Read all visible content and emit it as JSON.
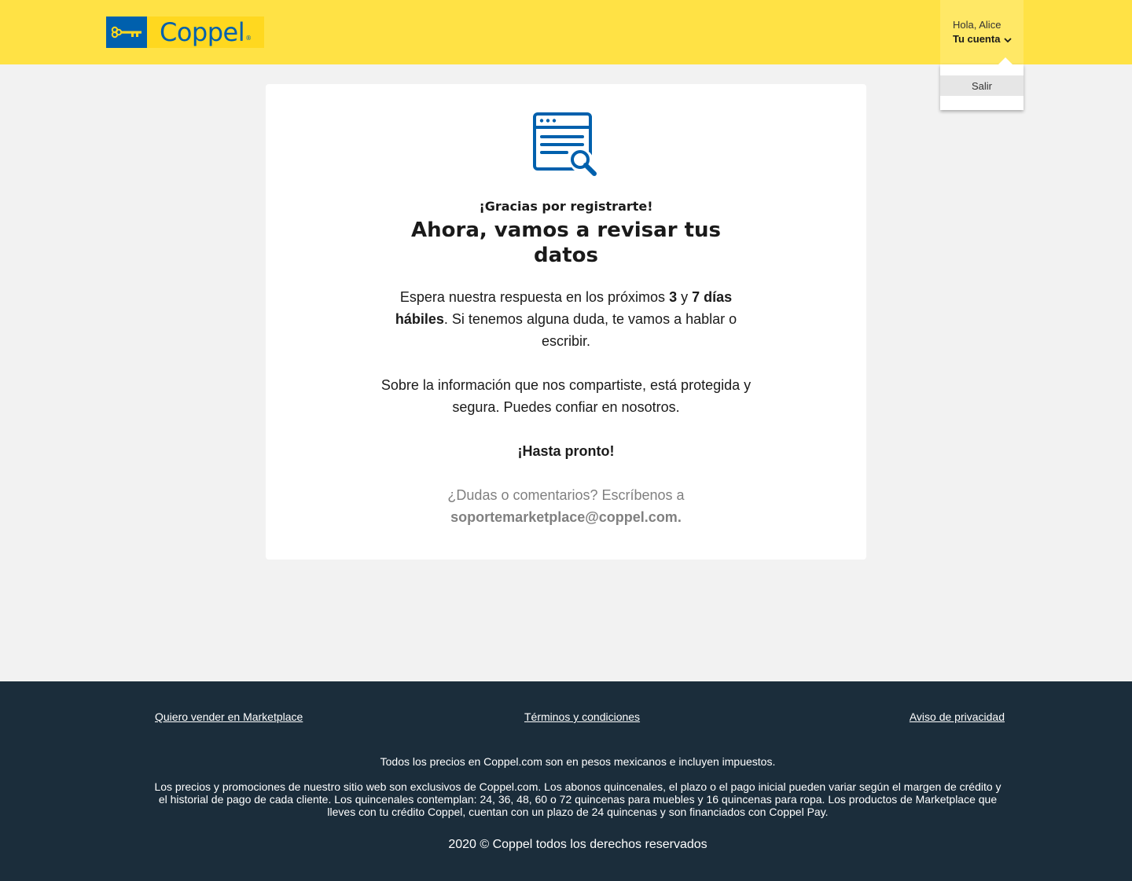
{
  "header": {
    "logo_text": "Coppel",
    "logo_mark": "®",
    "greeting": "Hola, Alice",
    "account_label": "Tu cuenta",
    "brand_yellow": "#ffe245",
    "brand_blue": "#0060ad"
  },
  "dropdown": {
    "items": [
      {
        "label": "Salir"
      }
    ]
  },
  "card": {
    "icon": "browser-search-icon",
    "thanks": "¡Gracias por registrarte!",
    "headline": "Ahora, vamos a revisar tus datos",
    "p1_a": "Espera nuestra respuesta en los próximos ",
    "p1_b": "3",
    "p1_c": " y ",
    "p1_d": "7 días hábiles",
    "p1_e": ". Si tenemos alguna duda, te vamos a hablar o escribir.",
    "p2": "Sobre la información que nos compartiste, está protegida y segura. Puedes confiar en nosotros.",
    "p3": "¡Hasta pronto!",
    "p4_a": "¿Dudas o comentarios? Escríbenos a ",
    "p4_email": "soportemarketplace@coppel.com."
  },
  "footer": {
    "links": [
      {
        "label": "Quiero vender en Marketplace"
      },
      {
        "label": "Términos y condiciones"
      },
      {
        "label": " Aviso de privacidad"
      }
    ],
    "prices_note": "Todos los precios en Coppel.com son en pesos mexicanos e incluyen impuestos.",
    "legal": "Los precios y promociones de nuestro sitio web son exclusivos de Coppel.com. Los abonos quincenales, el plazo o el pago inicial pueden variar según el margen de crédito y el historial de pago de cada cliente. Los quincenales contemplan: 24, 36, 48, 60 o 72 quincenas para muebles y 16 quincenas para ropa. Los productos de Marketplace que lleves con tu crédito Coppel, cuentan con un plazo de 24 quincenas y son financiados con Coppel Pay.",
    "copyright": "2020 © Coppel todos los derechos reservados",
    "background": "#1b2d3b"
  }
}
